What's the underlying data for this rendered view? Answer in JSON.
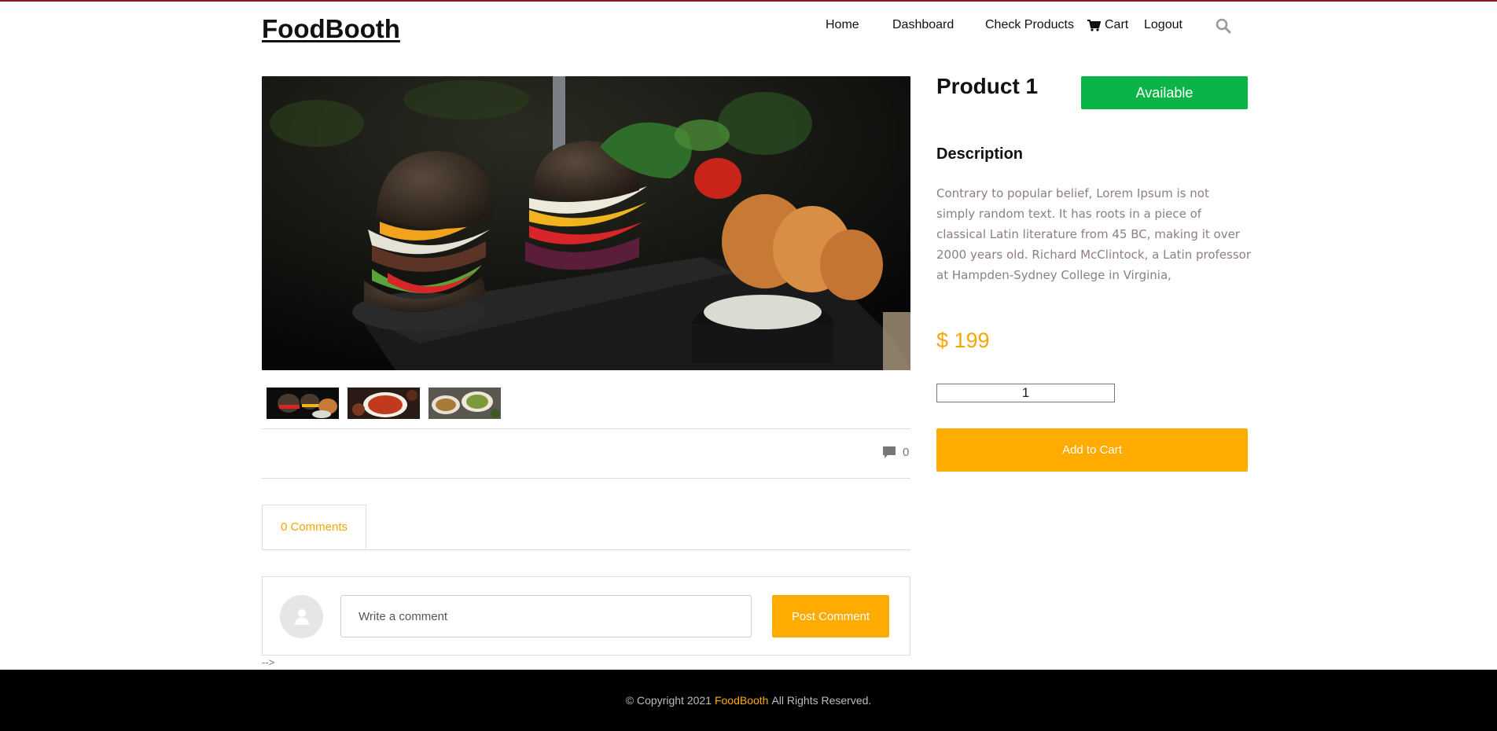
{
  "header": {
    "logo": "FoodBooth",
    "nav": {
      "home": "Home",
      "dashboard": "Dashboard",
      "check_products": "Check Products",
      "cart": "Cart",
      "logout": "Logout"
    },
    "icons": {
      "cart": "shopping-cart-icon",
      "search": "search-icon"
    }
  },
  "gallery": {
    "main_image": "burger-sliders-with-grilled-vegetables-and-dip",
    "thumbnails": [
      "burgers-thumbnail",
      "soup-dish-thumbnail",
      "salad-bowls-thumbnail"
    ]
  },
  "comments": {
    "count": "0",
    "tab_label": "0 Comments",
    "input_placeholder": "Write a comment",
    "post_button": "Post Comment"
  },
  "stray_text": "-->",
  "product": {
    "title": "Product 1",
    "status": "Available",
    "description_heading": "Description",
    "description": "Contrary to popular belief, Lorem Ipsum is not simply random text. It has roots in a piece of classical Latin literature from 45 BC, making it over 2000 years old. Richard McClintock, a Latin professor at Hampden-Sydney College in Virginia,",
    "price": "$ 199",
    "quantity": "1",
    "add_to_cart": "Add to Cart"
  },
  "footer": {
    "copyright_symbol": "©",
    "prefix": "Copyright 2021",
    "brand": "FoodBooth",
    "suffix": "All Rights Reserved."
  },
  "colors": {
    "accent": "#ffab00",
    "available": "#0ab446",
    "top_line": "#8b1a1a",
    "footer_bg": "#000000"
  }
}
